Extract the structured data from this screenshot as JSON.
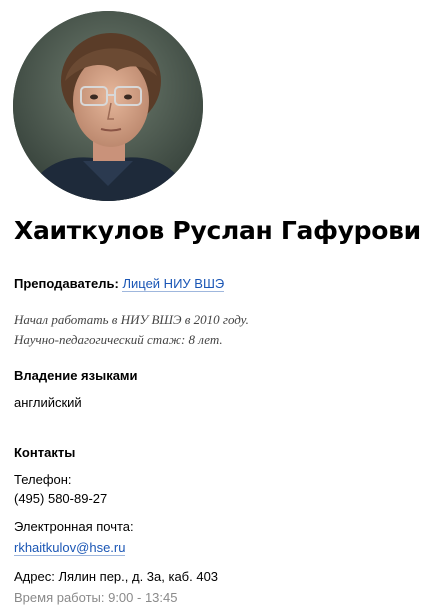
{
  "profile": {
    "name": "Хаиткулов Руслан Гафурович",
    "role_label": "Преподаватель:",
    "role_link": "Лицей НИУ ВШЭ",
    "bio_line1": "Начал работать в НИУ ВШЭ в 2010 году.",
    "bio_line2": "Научно-педагогический стаж: 8 лет."
  },
  "languages": {
    "title": "Владение языками",
    "value": "английский"
  },
  "contacts": {
    "title": "Контакты",
    "phone_label": "Телефон:",
    "phone_value": "(495) 580-89-27",
    "email_label": "Электронная почта:",
    "email_value": "rkhaitkulov@hse.ru",
    "address": "Адрес: Лялин пер., д. 3а, каб. 403",
    "hours": "Время работы: 9:00 - 13:45"
  },
  "colors": {
    "link": "#1a56b5",
    "muted": "#8a8a8a"
  }
}
